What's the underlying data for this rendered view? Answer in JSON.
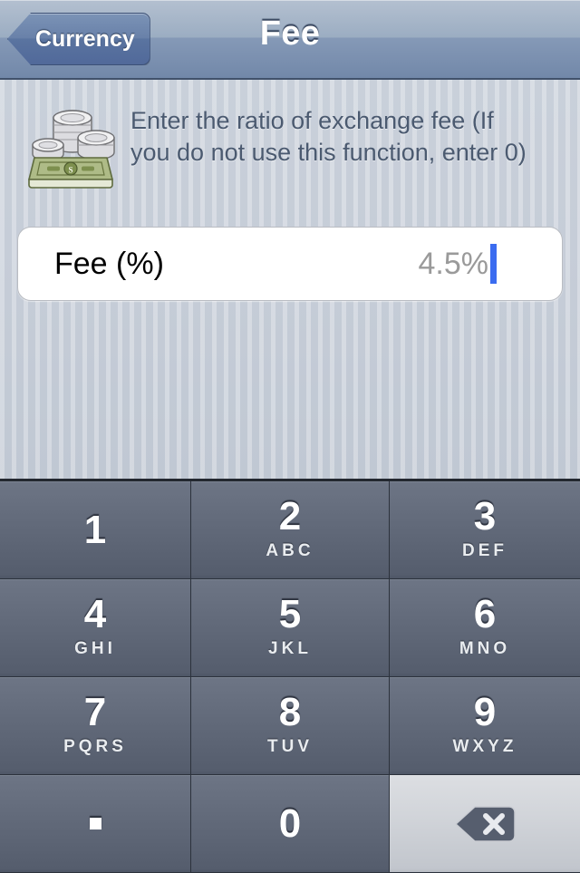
{
  "navbar": {
    "back_label": "Currency",
    "title": "Fee",
    "back_icon": "chevron-left-icon"
  },
  "content": {
    "icon_name": "money-coins-icon",
    "instruction": "Enter the ratio of exchange fee (If you do not use this function, enter 0)",
    "field": {
      "label": "Fee (%)",
      "placeholder": "4.5%",
      "value": "",
      "caret_color": "#3b6cf0"
    }
  },
  "keypad": {
    "keys": [
      {
        "digit": "1",
        "letters": "",
        "name": "key-1"
      },
      {
        "digit": "2",
        "letters": "ABC",
        "name": "key-2"
      },
      {
        "digit": "3",
        "letters": "DEF",
        "name": "key-3"
      },
      {
        "digit": "4",
        "letters": "GHI",
        "name": "key-4"
      },
      {
        "digit": "5",
        "letters": "JKL",
        "name": "key-5"
      },
      {
        "digit": "6",
        "letters": "MNO",
        "name": "key-6"
      },
      {
        "digit": "7",
        "letters": "PQRS",
        "name": "key-7"
      },
      {
        "digit": "8",
        "letters": "TUV",
        "name": "key-8"
      },
      {
        "digit": "9",
        "letters": "WXYZ",
        "name": "key-9"
      },
      {
        "digit": ".",
        "letters": "",
        "name": "key-period"
      },
      {
        "digit": "0",
        "letters": "",
        "name": "key-0"
      }
    ],
    "delete_icon": "backspace-delete-icon"
  },
  "colors": {
    "navbar_blue": "#7288a9",
    "back_button_blue": "#5a74a0",
    "content_bg": "#c6cdd8",
    "key_dark": "#666e7e",
    "key_light": "#d2d5da",
    "text_slate": "#4b5a70",
    "placeholder_gray": "#9a9a9a"
  }
}
